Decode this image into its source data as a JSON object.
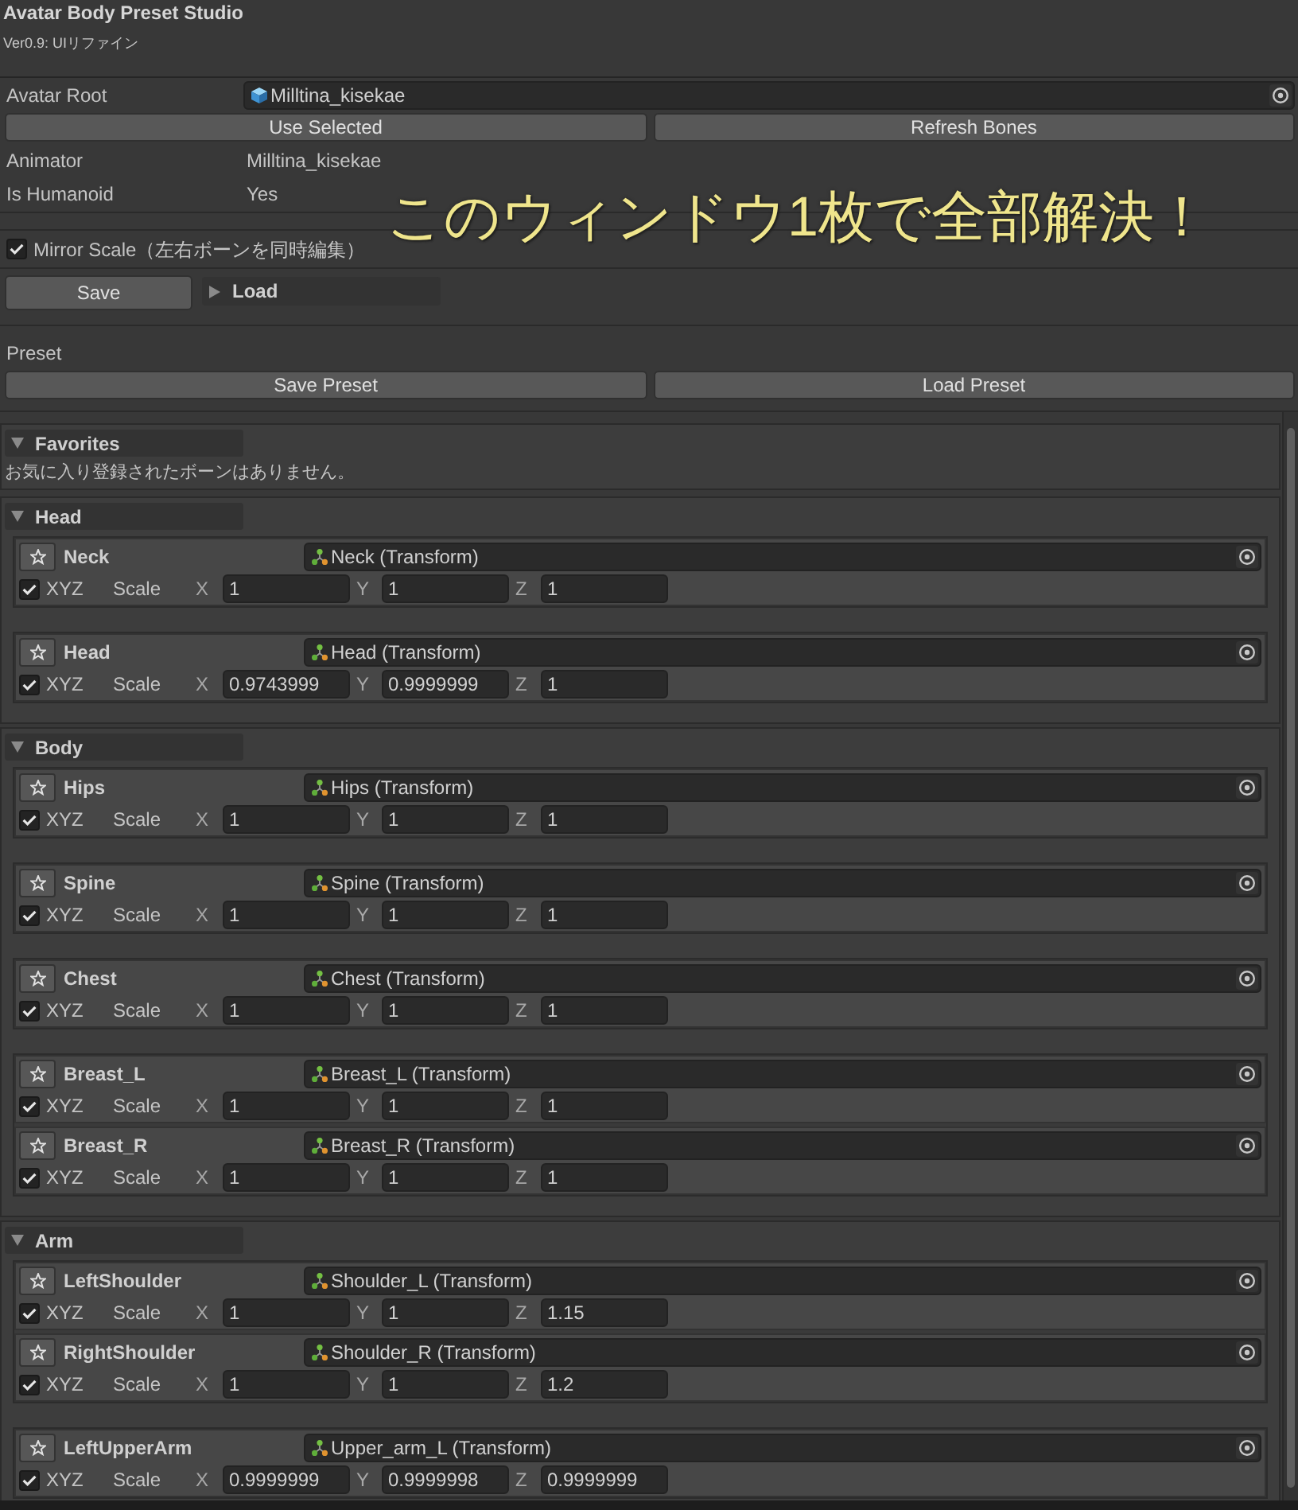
{
  "window": {
    "title": "Avatar Body Preset Studio",
    "version": "Ver0.9: UIリファイン"
  },
  "avatar": {
    "root": {
      "label": "Avatar Root",
      "value": "Milltina_kisekae"
    },
    "buttons": [
      "Use Selected",
      "Refresh Bones"
    ],
    "info": [
      {
        "label": "Animator",
        "value": "Milltina_kisekae"
      },
      {
        "label": "Is Humanoid",
        "value": "Yes"
      }
    ]
  },
  "caption": "このウィンドウ1枚で全部解決！",
  "mirror": {
    "label": "Mirror Scale（左右ボーンを同時編集）",
    "checked": true
  },
  "save_load": {
    "save": "Save",
    "load": {
      "label": "Load",
      "expanded": false
    }
  },
  "preset": {
    "title": "Preset",
    "buttons": [
      "Save Preset",
      "Load Preset"
    ]
  },
  "favorites": {
    "title": "Favorites",
    "expanded": true,
    "message": "お気に入り登録されたボーンはありません。"
  },
  "groups": [
    {
      "title": "Head",
      "expanded": true,
      "cards": [
        {
          "bones": [
            {
              "name": "Neck",
              "target": "Neck (Transform)",
              "xyz": {
                "label": "XYZ",
                "checked": true
              },
              "scale_label": "Scale",
              "axes": [
                {
                  "label": "X",
                  "value": "1"
                },
                {
                  "label": "Y",
                  "value": "1"
                },
                {
                  "label": "Z",
                  "value": "1"
                }
              ]
            }
          ]
        },
        {
          "bones": [
            {
              "name": "Head",
              "target": "Head (Transform)",
              "xyz": {
                "label": "XYZ",
                "checked": true
              },
              "scale_label": "Scale",
              "axes": [
                {
                  "label": "X",
                  "value": "0.9743999"
                },
                {
                  "label": "Y",
                  "value": "0.9999999"
                },
                {
                  "label": "Z",
                  "value": "1"
                }
              ]
            }
          ]
        }
      ]
    },
    {
      "title": "Body",
      "expanded": true,
      "cards": [
        {
          "bones": [
            {
              "name": "Hips",
              "target": "Hips (Transform)",
              "xyz": {
                "label": "XYZ",
                "checked": true
              },
              "scale_label": "Scale",
              "axes": [
                {
                  "label": "X",
                  "value": "1"
                },
                {
                  "label": "Y",
                  "value": "1"
                },
                {
                  "label": "Z",
                  "value": "1"
                }
              ]
            }
          ]
        },
        {
          "bones": [
            {
              "name": "Spine",
              "target": "Spine (Transform)",
              "xyz": {
                "label": "XYZ",
                "checked": true
              },
              "scale_label": "Scale",
              "axes": [
                {
                  "label": "X",
                  "value": "1"
                },
                {
                  "label": "Y",
                  "value": "1"
                },
                {
                  "label": "Z",
                  "value": "1"
                }
              ]
            }
          ]
        },
        {
          "bones": [
            {
              "name": "Chest",
              "target": "Chest (Transform)",
              "xyz": {
                "label": "XYZ",
                "checked": true
              },
              "scale_label": "Scale",
              "axes": [
                {
                  "label": "X",
                  "value": "1"
                },
                {
                  "label": "Y",
                  "value": "1"
                },
                {
                  "label": "Z",
                  "value": "1"
                }
              ]
            }
          ]
        },
        {
          "bones": [
            {
              "name": "Breast_L",
              "target": "Breast_L (Transform)",
              "xyz": {
                "label": "XYZ",
                "checked": true
              },
              "scale_label": "Scale",
              "axes": [
                {
                  "label": "X",
                  "value": "1"
                },
                {
                  "label": "Y",
                  "value": "1"
                },
                {
                  "label": "Z",
                  "value": "1"
                }
              ]
            },
            {
              "name": "Breast_R",
              "target": "Breast_R (Transform)",
              "xyz": {
                "label": "XYZ",
                "checked": true
              },
              "scale_label": "Scale",
              "axes": [
                {
                  "label": "X",
                  "value": "1"
                },
                {
                  "label": "Y",
                  "value": "1"
                },
                {
                  "label": "Z",
                  "value": "1"
                }
              ]
            }
          ]
        }
      ]
    },
    {
      "title": "Arm",
      "expanded": true,
      "cards": [
        {
          "bones": [
            {
              "name": "LeftShoulder",
              "target": "Shoulder_L (Transform)",
              "xyz": {
                "label": "XYZ",
                "checked": true
              },
              "scale_label": "Scale",
              "axes": [
                {
                  "label": "X",
                  "value": "1"
                },
                {
                  "label": "Y",
                  "value": "1"
                },
                {
                  "label": "Z",
                  "value": "1.15"
                }
              ]
            },
            {
              "name": "RightShoulder",
              "target": "Shoulder_R (Transform)",
              "xyz": {
                "label": "XYZ",
                "checked": true
              },
              "scale_label": "Scale",
              "axes": [
                {
                  "label": "X",
                  "value": "1"
                },
                {
                  "label": "Y",
                  "value": "1"
                },
                {
                  "label": "Z",
                  "value": "1.2"
                }
              ]
            }
          ]
        },
        {
          "bones": [
            {
              "name": "LeftUpperArm",
              "target": "Upper_arm_L (Transform)",
              "xyz": {
                "label": "XYZ",
                "checked": true
              },
              "scale_label": "Scale",
              "axes": [
                {
                  "label": "X",
                  "value": "0.9999999"
                },
                {
                  "label": "Y",
                  "value": "0.9999998"
                },
                {
                  "label": "Z",
                  "value": "0.9999999"
                }
              ]
            }
          ]
        }
      ]
    }
  ]
}
